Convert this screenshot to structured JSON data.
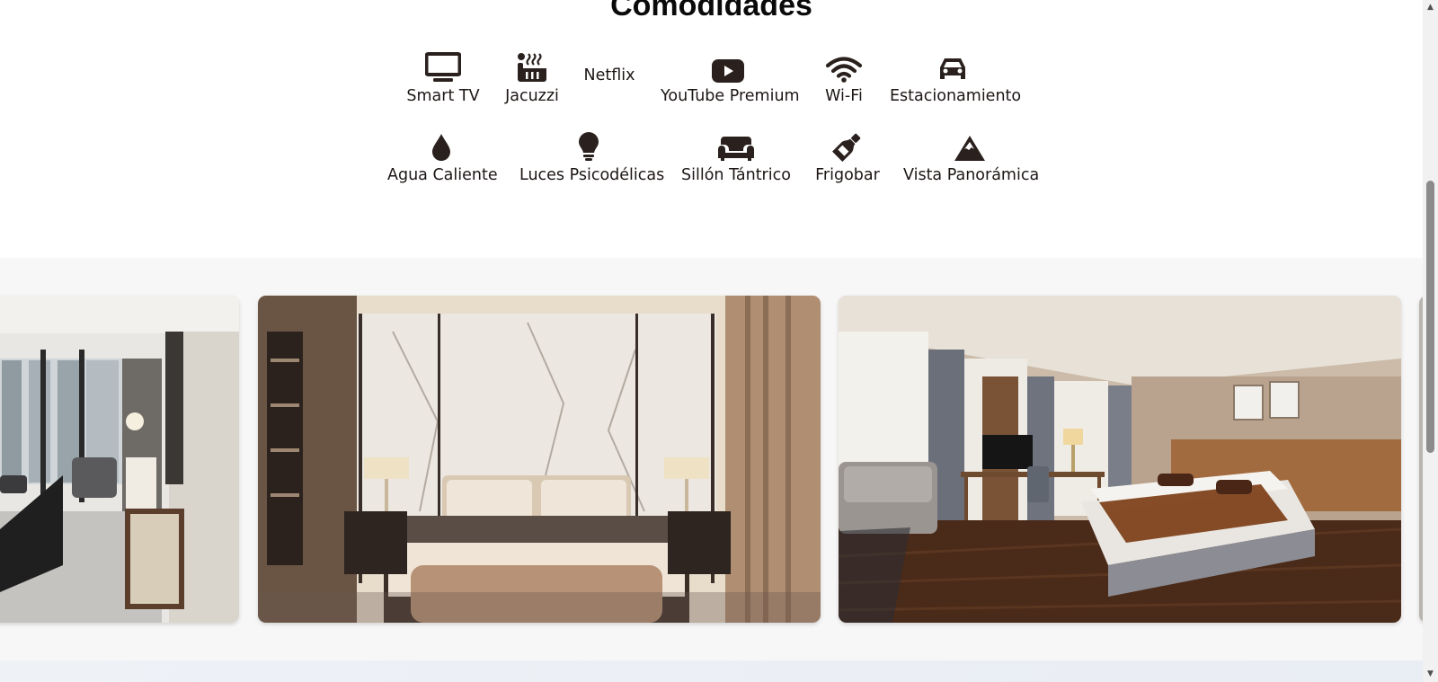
{
  "amenities": {
    "title": "Comodidades",
    "items": [
      {
        "label": "Smart TV",
        "icon": "tv-icon"
      },
      {
        "label": "Jacuzzi",
        "icon": "hot-tub-icon"
      },
      {
        "label": "Netflix",
        "icon": ""
      },
      {
        "label": "YouTube Premium",
        "icon": "youtube-icon"
      },
      {
        "label": "Wi-Fi",
        "icon": "wifi-icon"
      },
      {
        "label": "Estacionamiento",
        "icon": "car-icon"
      },
      {
        "label": "Agua Caliente",
        "icon": "water-drop-icon"
      },
      {
        "label": "Luces Psicodélicas",
        "icon": "lightbulb-icon"
      },
      {
        "label": "Sillón Tántrico",
        "icon": "couch-icon"
      },
      {
        "label": "Frigobar",
        "icon": "bottle-icon"
      },
      {
        "label": "Vista Panorámica",
        "icon": "mountain-icon"
      }
    ]
  },
  "gallery": {
    "slides": [
      {
        "name": "living-room-photo"
      },
      {
        "name": "marble-bedroom-photo"
      },
      {
        "name": "hotel-bedroom-photo"
      }
    ]
  },
  "colors": {
    "icon": "#2a211e",
    "text": "#1c1614",
    "gallery_bg": "#f7f7f7"
  }
}
